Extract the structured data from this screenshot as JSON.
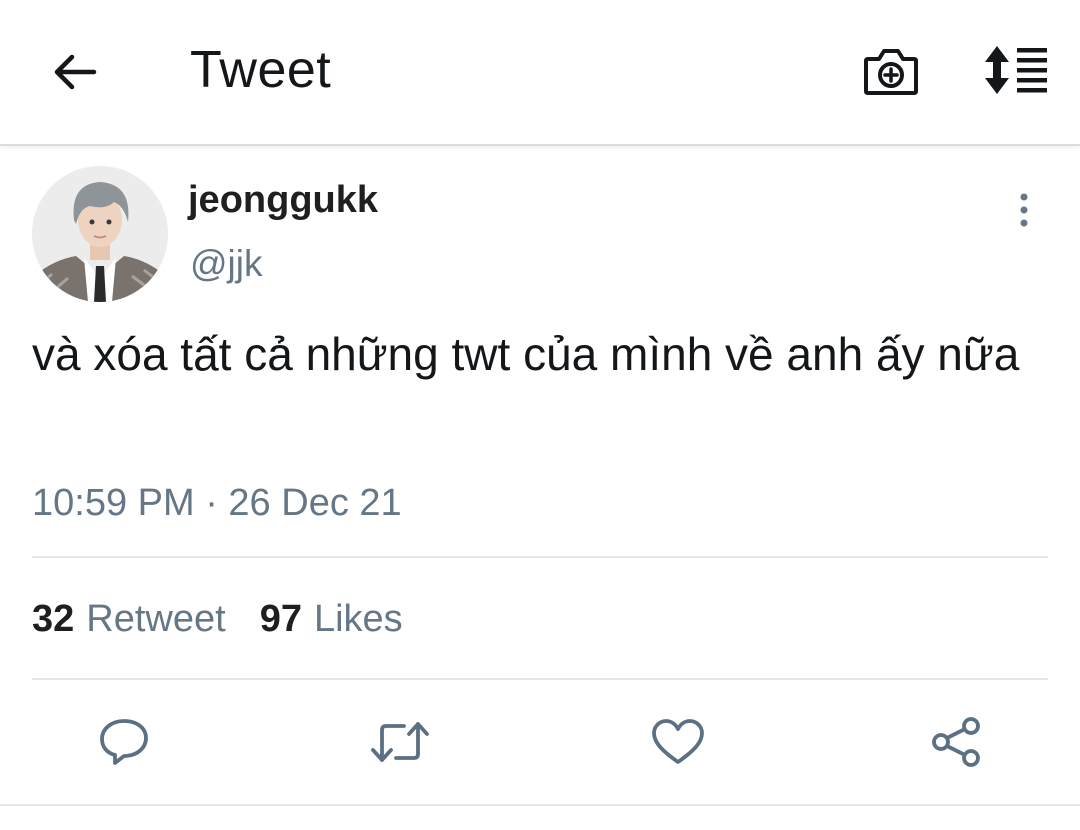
{
  "header": {
    "title": "Tweet",
    "back_icon": "arrow-left-icon",
    "camera_icon": "camera-plus-icon",
    "sort_icon": "sort-list-icon"
  },
  "tweet": {
    "display_name": "jeonggukk",
    "handle": "@jjk",
    "text": "và xóa tất cả những twt của mình về anh ấy nữa",
    "timestamp": "10:59 PM · 26 Dec 21",
    "more_icon": "more-vertical-icon"
  },
  "stats": {
    "retweet_count": "32",
    "retweet_label": "Retweet",
    "likes_count": "97",
    "likes_label": "Likes"
  },
  "actions": [
    {
      "icon": "reply-icon"
    },
    {
      "icon": "retweet-icon"
    },
    {
      "icon": "heart-icon"
    },
    {
      "icon": "share-icon"
    }
  ],
  "colors": {
    "text_primary": "#14171a",
    "text_secondary": "#657786",
    "divider": "#e3e6e8",
    "icon": "#5b7083"
  }
}
